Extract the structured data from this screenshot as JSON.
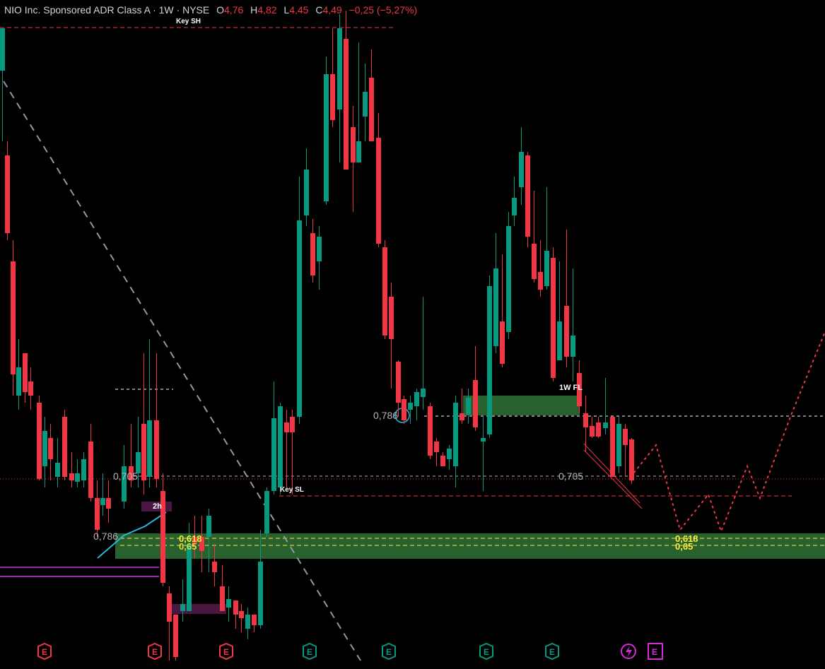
{
  "header": {
    "symbol": "NIO Inc. Sponsored ADR Class A · 1W · NYSE",
    "o_label": "O",
    "o_value": "4,76",
    "h_label": "H",
    "h_value": "4,82",
    "l_label": "L",
    "l_value": "4,45",
    "c_label": "C",
    "c_value": "4,49",
    "change": "−0,25 (−5,27%)"
  },
  "annotations": {
    "key_sh": "Key SH",
    "key_sl": "Key SL",
    "fib_786_left": "0,786",
    "fib_705_left": "0,705",
    "fib_786_mid": "0,786",
    "fib_705_right": "0,705",
    "fib_618_left": "0,618",
    "fib_65_left": "0,65",
    "fib_618_right": "0,618",
    "fib_65_right": "0,65",
    "tf_2h": "2h",
    "label_1w": "1W FL"
  },
  "events": {
    "earnings_letter": "E",
    "badges": [
      {
        "kind": "earnings",
        "color": "#f23645",
        "x_index": 0
      },
      {
        "kind": "earnings",
        "color": "#f23645",
        "x_index": 1
      },
      {
        "kind": "earnings",
        "color": "#f23645",
        "x_index": 2
      },
      {
        "kind": "earnings",
        "color": "#089981",
        "x_index": 3
      },
      {
        "kind": "earnings",
        "color": "#089981",
        "x_index": 4
      },
      {
        "kind": "earnings",
        "color": "#089981",
        "x_index": 5
      },
      {
        "kind": "earnings",
        "color": "#089981",
        "x_index": 6
      },
      {
        "kind": "lightning",
        "color": "#d62ad9",
        "x_index": 7
      },
      {
        "kind": "earnings-upcoming",
        "color": "#d62ad9",
        "x_index": 8
      }
    ]
  },
  "colors": {
    "up": "#089981",
    "down": "#f23645",
    "zone": "#2e6b33",
    "purple": "#9c27b0",
    "fib_text": "#ffeb3b",
    "cyan": "#29b6d8"
  },
  "chart_data": {
    "type": "candlestick",
    "title": "NIO Inc. Sponsored ADR Class A · 1W · NYSE",
    "timeframe": "1W",
    "last_bar": {
      "open": 4.76,
      "high": 4.82,
      "low": 4.45,
      "close": 4.49,
      "change": -0.25,
      "change_pct": -5.27
    },
    "candle_colors": {
      "up": "#089981",
      "down": "#f23645"
    },
    "levels": [
      {
        "name": "Key SH",
        "style": "dashed",
        "color": "#f23645"
      },
      {
        "name": "Key SL",
        "style": "dashed",
        "color": "#f23645"
      },
      {
        "name": "0,786",
        "style": "dashed",
        "color": "#ffffff"
      },
      {
        "name": "0,705",
        "style": "dotted",
        "color": "#f23645"
      },
      {
        "name": "0,618",
        "style": "dashed",
        "color": "#ffeb3b"
      },
      {
        "name": "0,65",
        "style": "dashed",
        "color": "#ffeb3b"
      }
    ],
    "zones": [
      {
        "name": "demand zone (0,618–0,65)",
        "color": "#2e6b33"
      },
      {
        "name": "1W FL zone",
        "color": "#2e6b33"
      }
    ],
    "projection": {
      "style": "dotted",
      "color": "#f23645",
      "description": "zigzag down into 0,618 zone then up"
    },
    "grid": false
  }
}
